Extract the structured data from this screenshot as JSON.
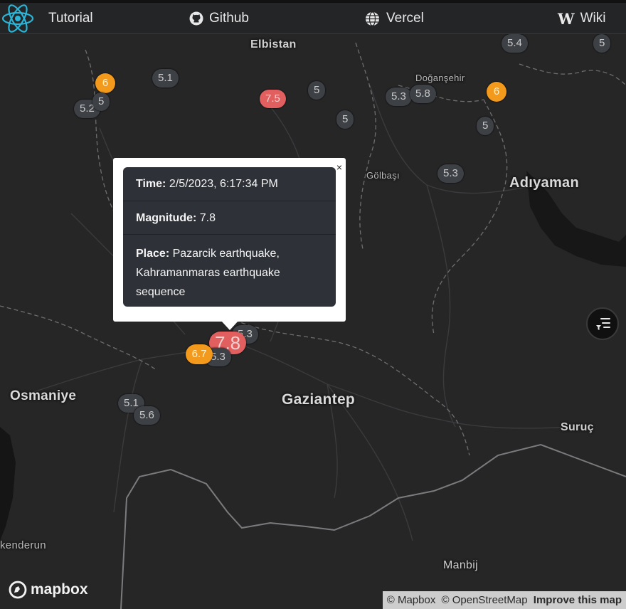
{
  "nav": {
    "logo_icon": "react-logo-icon",
    "tutorial_label": "Tutorial",
    "github_label": "Github",
    "github_icon": "github-icon",
    "vercel_label": "Vercel",
    "vercel_icon": "globe-icon",
    "wiki_label": "Wiki",
    "wiki_icon": "wikipedia-icon"
  },
  "map": {
    "places": [
      "Elbistan",
      "Doğanşehir",
      "Adıyaman",
      "Gölbaşı",
      "Osmaniye",
      "Gaziantep",
      "Suruç",
      "kenderun",
      "Manbij"
    ],
    "markers": [
      "6",
      "5.1",
      "5",
      "5.2",
      "7.5",
      "5",
      "5",
      "5.3",
      "5.8",
      "5.4",
      "5",
      "6",
      "5",
      "5.3",
      "5.3",
      "7.8",
      "6.7",
      "5.3",
      "5.1",
      "5.6"
    ],
    "colors": {
      "orange": "#f39a1c",
      "red": "#e15f5f",
      "gray": "#3d4045"
    }
  },
  "popup": {
    "time_label": "Time:",
    "time_value": "2/5/2023, 6:17:34 PM",
    "magnitude_label": "Magnitude:",
    "magnitude_value": "7.8",
    "place_label": "Place:",
    "place_value": "Pazarcik earthquake, Kahramanmaras earthquake sequence",
    "close_label": "×"
  },
  "controls": {
    "filter_icon": "filter-list-icon"
  },
  "footer": {
    "logo_text": "mapbox",
    "attrib_mapbox": "© Mapbox",
    "attrib_osm": "© OpenStreetMap",
    "attrib_improve": "Improve this map"
  }
}
